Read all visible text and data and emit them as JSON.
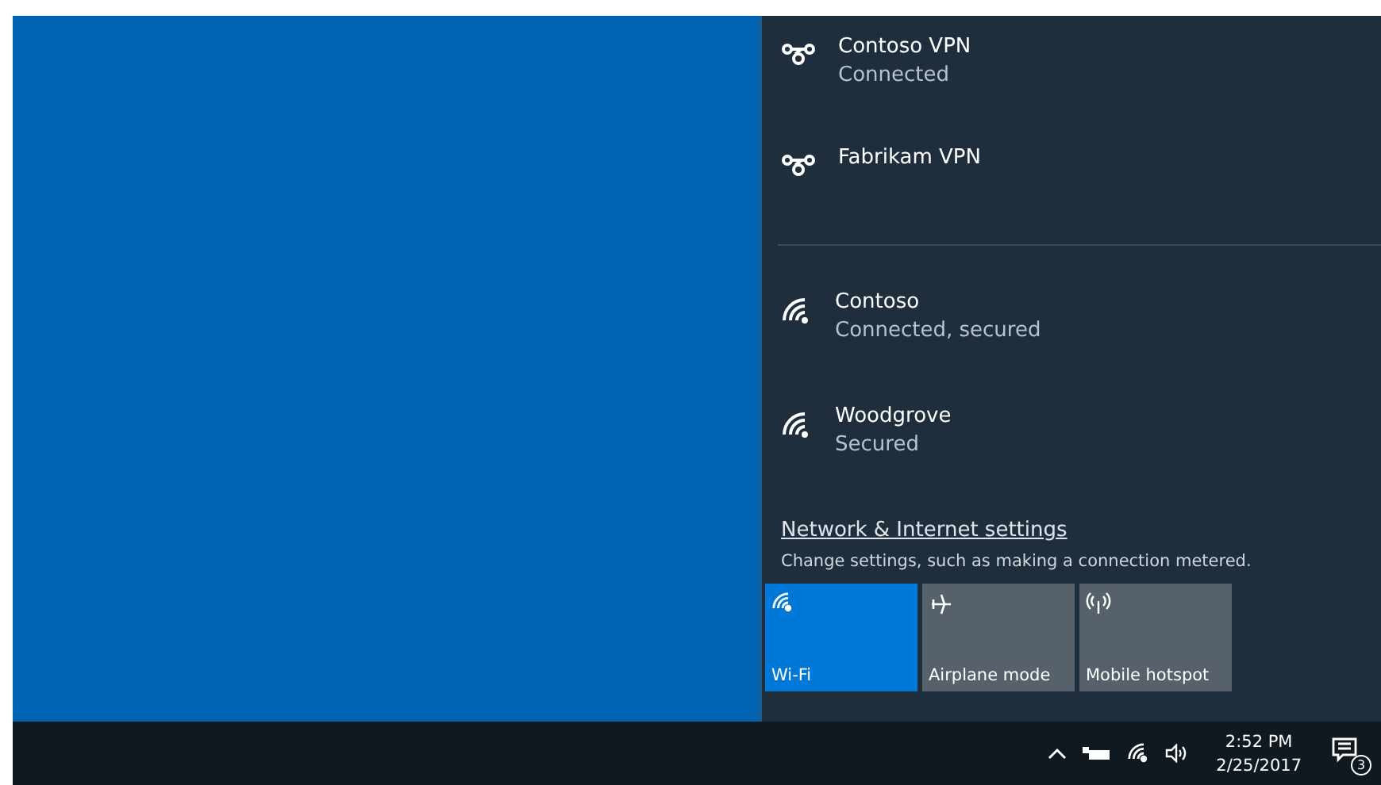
{
  "vpn_connections": [
    {
      "name": "Contoso VPN",
      "status": "Connected"
    },
    {
      "name": "Fabrikam VPN"
    }
  ],
  "wifi_networks": [
    {
      "name": "Contoso",
      "status": "Connected, secured"
    },
    {
      "name": "Woodgrove",
      "status": "Secured"
    }
  ],
  "settings_link": {
    "label": "Network & Internet settings",
    "description": "Change settings, such as making a connection metered."
  },
  "quick_actions": [
    {
      "kind": "wifi",
      "label": "Wi-Fi",
      "on": true
    },
    {
      "kind": "airplane",
      "label": "Airplane mode",
      "on": false
    },
    {
      "kind": "hotspot",
      "label": "Mobile hotspot",
      "on": false
    }
  ],
  "taskbar": {
    "time": "2:52 PM",
    "date": "2/25/2017",
    "notification_count": "3"
  }
}
